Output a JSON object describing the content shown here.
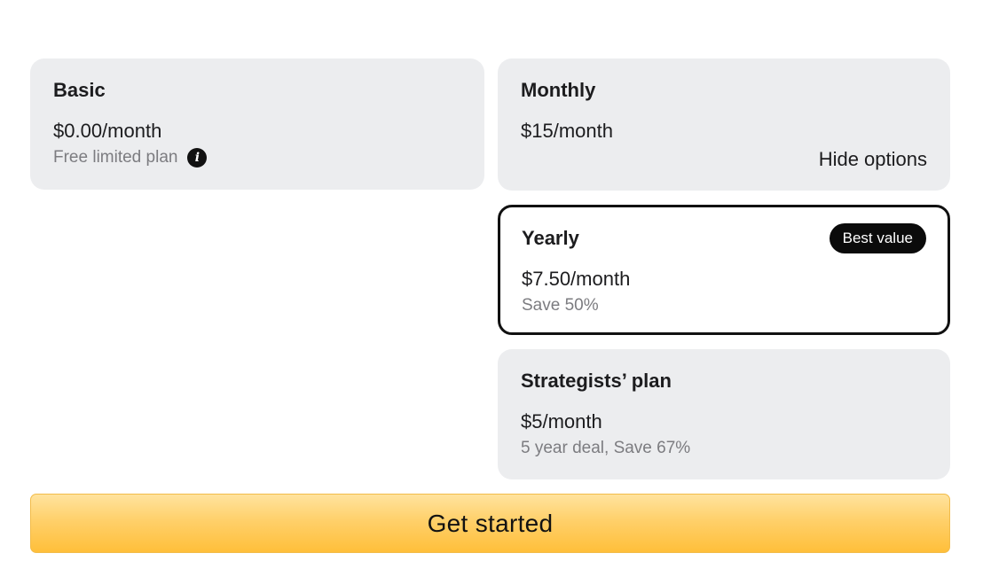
{
  "plans": {
    "basic": {
      "title": "Basic",
      "price": "$0.00/month",
      "subtitle": "Free limited plan",
      "info_icon": "info-icon"
    },
    "monthly": {
      "title": "Monthly",
      "price": "$15/month",
      "toggle_label": "Hide options"
    },
    "yearly": {
      "title": "Yearly",
      "price": "$7.50/month",
      "subtitle": "Save 50%",
      "badge": "Best value",
      "selected": true
    },
    "strategists": {
      "title": "Strategists’ plan",
      "price": "$5/month",
      "subtitle": "5 year deal, Save 67%"
    }
  },
  "cta": {
    "label": "Get started"
  },
  "colors": {
    "card_background": "#ecedef",
    "selected_border": "#111111",
    "badge_background": "#0b0b0b",
    "cta_gradient_top": "#ffe39e",
    "cta_gradient_bottom": "#ffbf3a",
    "muted_text": "#7c7c80"
  }
}
